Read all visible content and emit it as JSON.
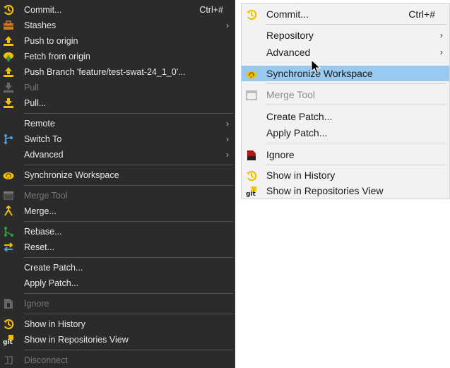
{
  "dark_menu": {
    "commit": {
      "label": "Commit...",
      "shortcut": "Ctrl+#",
      "icon": "commit-icon"
    },
    "stashes": {
      "label": "Stashes",
      "icon": "stash-icon"
    },
    "push_to_origin": {
      "label": "Push to origin",
      "icon": "push-icon"
    },
    "fetch_from_origin": {
      "label": "Fetch from origin",
      "icon": "fetch-icon"
    },
    "push_branch": {
      "label": "Push Branch 'feature/test-swat-24_1_0'...",
      "icon": "push-branch-icon"
    },
    "pull": {
      "label": "Pull",
      "icon": "pull-icon"
    },
    "pull_dialog": {
      "label": "Pull...",
      "icon": "pull-icon"
    },
    "remote": {
      "label": "Remote"
    },
    "switch_to": {
      "label": "Switch To",
      "icon": "branch-icon"
    },
    "advanced": {
      "label": "Advanced"
    },
    "synchronize": {
      "label": "Synchronize Workspace",
      "icon": "sync-icon"
    },
    "merge_tool": {
      "label": "Merge Tool",
      "icon": "merge-tool-icon"
    },
    "merge": {
      "label": "Merge...",
      "icon": "merge-icon"
    },
    "rebase": {
      "label": "Rebase...",
      "icon": "rebase-icon"
    },
    "reset": {
      "label": "Reset...",
      "icon": "reset-icon"
    },
    "create_patch": {
      "label": "Create Patch..."
    },
    "apply_patch": {
      "label": "Apply Patch..."
    },
    "ignore": {
      "label": "Ignore",
      "icon": "ignore-icon"
    },
    "show_in_history": {
      "label": "Show in History",
      "icon": "history-icon"
    },
    "show_in_repositories": {
      "label": "Show in Repositories View",
      "icon": "git-icon"
    },
    "disconnect": {
      "label": "Disconnect",
      "icon": "disconnect-icon"
    }
  },
  "light_menu": {
    "commit": {
      "label": "Commit...",
      "shortcut": "Ctrl+#",
      "icon": "commit-icon"
    },
    "repository": {
      "label": "Repository"
    },
    "advanced": {
      "label": "Advanced"
    },
    "synchronize": {
      "label": "Synchronize Workspace",
      "icon": "sync-icon"
    },
    "merge_tool": {
      "label": "Merge Tool",
      "icon": "merge-tool-icon"
    },
    "create_patch": {
      "label": "Create Patch..."
    },
    "apply_patch": {
      "label": "Apply Patch..."
    },
    "ignore": {
      "label": "Ignore",
      "icon": "ignore-icon"
    },
    "show_in_history": {
      "label": "Show in History",
      "icon": "history-icon"
    },
    "show_in_repositories": {
      "label": "Show in Repositories View",
      "icon": "git-icon"
    }
  },
  "submenu_arrow": "›",
  "colors": {
    "dark_bg": "#2b2b2b",
    "light_bg": "#f2f2f2",
    "highlight": "#99c9ef",
    "icon_yellow": "#f0c000",
    "icon_green": "#2ea043"
  }
}
